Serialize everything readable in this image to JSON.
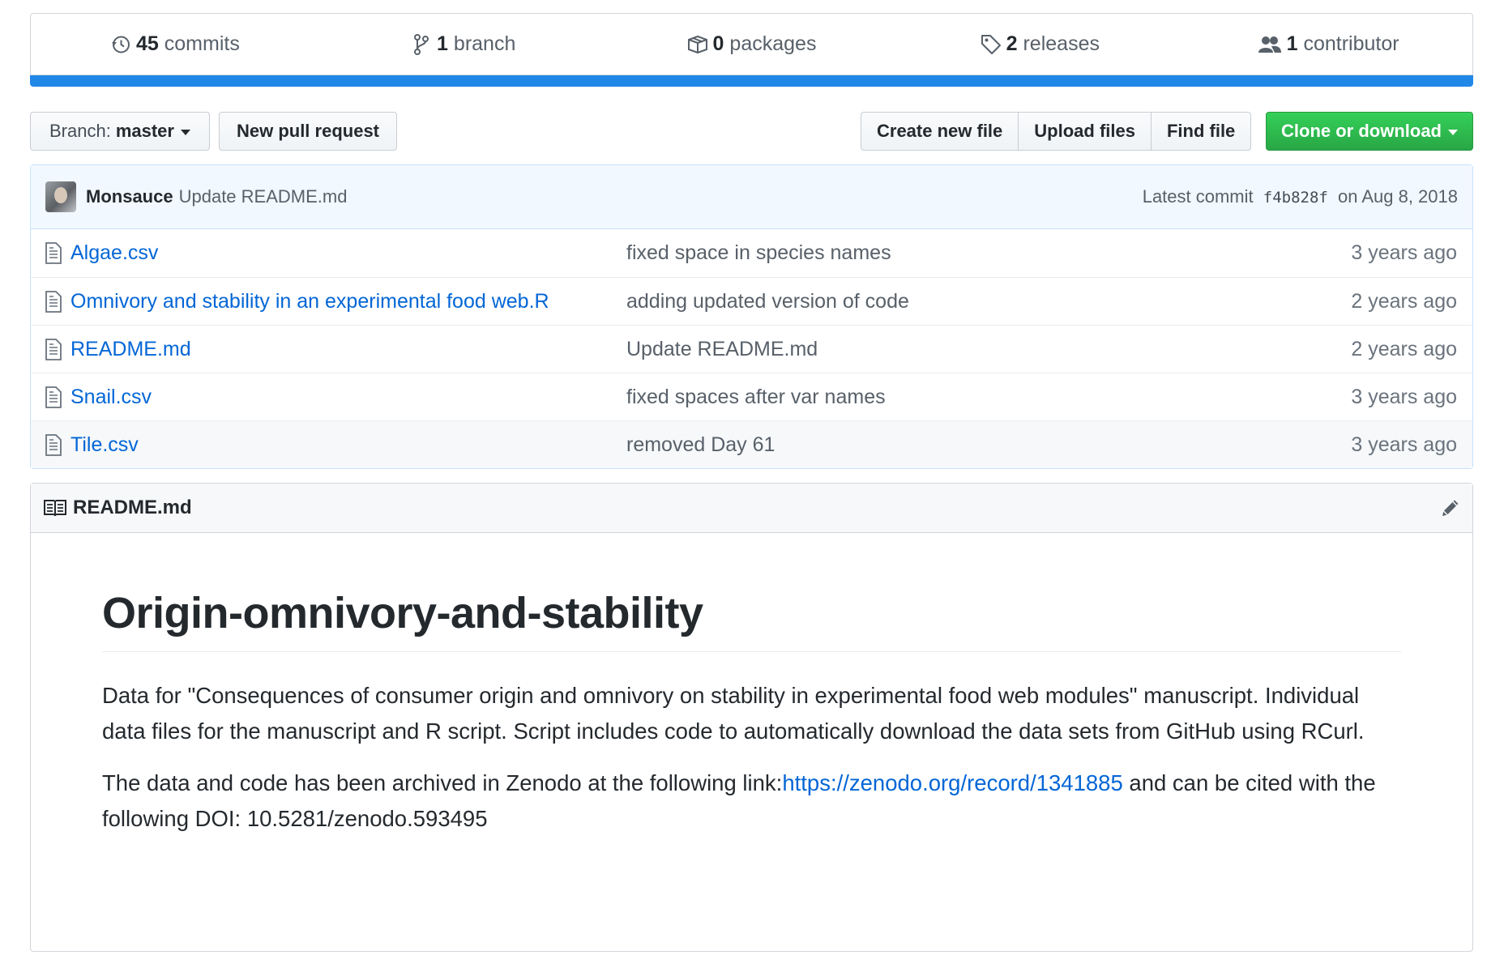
{
  "summary": {
    "commits": {
      "num": "45",
      "label": "commits",
      "icon": "history-icon"
    },
    "branches": {
      "num": "1",
      "label": "branch",
      "icon": "git-branch-icon"
    },
    "packages": {
      "num": "0",
      "label": "packages",
      "icon": "package-icon"
    },
    "releases": {
      "num": "2",
      "label": "releases",
      "icon": "tag-icon"
    },
    "contributors": {
      "num": "1",
      "label": "contributor",
      "icon": "people-icon"
    },
    "language_bar_color": "#2188e8"
  },
  "toolbar": {
    "branch_prefix": "Branch:",
    "branch_name": "master",
    "new_pr": "New pull request",
    "create_file": "Create new file",
    "upload_files": "Upload files",
    "find_file": "Find file",
    "clone": "Clone or download",
    "clone_color": "#28a745"
  },
  "latest_commit": {
    "author": "Monsauce",
    "message": "Update README.md",
    "prefix": "Latest commit",
    "sha": "f4b828f",
    "date": "on Aug 8, 2018"
  },
  "files": [
    {
      "name": "Algae.csv",
      "message": "fixed space in species names",
      "age": "3 years ago"
    },
    {
      "name": "Omnivory and stability in an experimental food web.R",
      "message": "adding updated version of code",
      "age": "2 years ago"
    },
    {
      "name": "README.md",
      "message": "Update README.md",
      "age": "2 years ago"
    },
    {
      "name": "Snail.csv",
      "message": "fixed spaces after var names",
      "age": "3 years ago"
    },
    {
      "name": "Tile.csv",
      "message": "removed Day 61",
      "age": "3 years ago"
    }
  ],
  "readme": {
    "header": "README.md",
    "title": "Origin-omnivory-and-stability",
    "para1": "Data for \"Consequences of consumer origin and omnivory on stability in experimental food web modules\" manuscript. Individual data files for the manuscript and R script. Script includes code to automatically download the data sets from GitHub using RCurl.",
    "para2_before": "The data and code has been archived in Zenodo at the following link:",
    "para2_link": "https://zenodo.org/record/1341885",
    "para2_after": " and can be cited with the following DOI: 10.5281/zenodo.593495"
  }
}
